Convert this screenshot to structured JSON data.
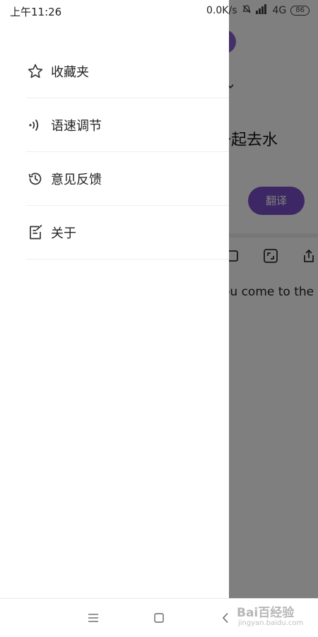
{
  "status_bar": {
    "time": "上午11:26",
    "speed": "0.0K/s",
    "network": "4G",
    "battery": "86"
  },
  "background_app": {
    "title_fragment": "一起去水",
    "translate_button": "翻译",
    "english_fragment": "ou come to the"
  },
  "drawer": {
    "items": [
      {
        "label": "收藏夹",
        "icon": "star-icon"
      },
      {
        "label": "语速调节",
        "icon": "sound-wave-icon"
      },
      {
        "label": "意见反馈",
        "icon": "history-icon"
      },
      {
        "label": "关于",
        "icon": "edit-note-icon"
      }
    ]
  },
  "navigation": {
    "icons": [
      "menu-icon",
      "home-icon",
      "back-icon"
    ]
  },
  "watermark": {
    "brand": "Bai百经验",
    "site": "jingyan.baidu.com"
  },
  "colors": {
    "accent": "#7b4fc8",
    "scrim": "rgba(0,0,0,0.5)"
  }
}
